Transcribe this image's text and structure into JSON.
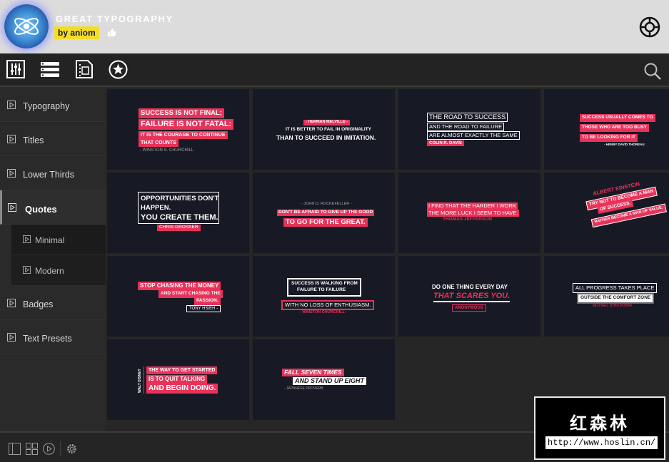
{
  "header": {
    "app_title": "GREAT TYPOGRAPHY",
    "author": "by aniom"
  },
  "sidebar": {
    "categories": [
      {
        "label": "Typography"
      },
      {
        "label": "Titles"
      },
      {
        "label": "Lower Thirds"
      },
      {
        "label": "Quotes"
      },
      {
        "label": "Badges"
      },
      {
        "label": "Text Presets"
      }
    ],
    "subcategories": [
      {
        "label": "Minimal"
      },
      {
        "label": "Modern"
      }
    ]
  },
  "tiles": [
    {
      "lines": [
        "SUCCESS IS NOT FINAL;",
        "FAILURE IS NOT FATAL:",
        "IT IS THE COURAGE TO CONTINUE",
        "THAT COUNTS",
        "- WINSTON S. CHURCHILL"
      ]
    },
    {
      "lines": [
        "- HERMAN MELVILLE -",
        "IT IS BETTER TO FAIL IN ORIGINALITY",
        "THAN TO SUCCEED IN IMITATION."
      ]
    },
    {
      "lines": [
        "THE ROAD TO SUCCESS",
        "AND THE ROAD TO FAILURE",
        "ARE ALMOST EXACTLY THE SAME",
        "COLIN R. DAVIS"
      ]
    },
    {
      "lines": [
        "SUCCESS USUALLY COMES TO",
        "THOSE WHO ARE TOO BUSY",
        "TO BE LOOKING FOR IT",
        "- HENRY DAVID THOREAU"
      ]
    },
    {
      "lines": [
        "OPPORTUNITIES DON'T",
        "HAPPEN.",
        "YOU CREATE THEM.",
        "CHRIS GROSSER"
      ]
    },
    {
      "lines": [
        "- JOHN D. ROCKEFELLER -",
        "DON'T BE AFRAID TO GIVE UP THE GOOD",
        "TO GO FOR THE GREAT."
      ]
    },
    {
      "lines": [
        "I FIND THAT THE HARDER I WORK",
        "THE MORE LUCK I SEEM TO HAVE.",
        "THOMAS JEFFERSON"
      ]
    },
    {
      "lines": [
        "ALBERT EINSTEIN",
        "TRY NOT TO BECOME A MAN",
        "OF SUCCESS.",
        "RATHER BECOME A MAN OF VALUE."
      ]
    },
    {
      "lines": [
        "STOP CHASING THE MONEY",
        "AND START CHASING THE",
        "PASSION.",
        "TONY HSIEH -"
      ]
    },
    {
      "lines": [
        "SUCCESS IS WALKING FROM",
        "FAILURE TO FAILURE",
        "WITH NO LOSS OF ENTHUSIASM.",
        "- WINSTON CHURCHILL -"
      ]
    },
    {
      "lines": [
        "DO ONE THING EVERY DAY",
        "THAT SCARES YOU.",
        "ANONYMOUS"
      ]
    },
    {
      "lines": [
        "ALL PROGRESS TAKES PLACE",
        "OUTSIDE THE COMFORT ZONE",
        "MICHAEL JOHN BOBAK"
      ]
    },
    {
      "lines": [
        "WALT DISNEY",
        "THE WAY TO GET STARTED",
        "IS TO QUIT TALKING",
        "AND BEGIN DOING."
      ]
    },
    {
      "lines": [
        "FALL SEVEN TIMES",
        "AND STAND UP EIGHT",
        "- JAPANESE PROVERB"
      ]
    }
  ],
  "watermark": {
    "chinese": "红森林",
    "url": "http://www.hoslin.cn/"
  },
  "icons": {
    "logo": "atom-logo-icon",
    "like": "thumbs-up-icon",
    "help": "lifebuoy-icon",
    "toolbar": [
      "sliders-icon",
      "list-icon",
      "film-icon",
      "star-icon"
    ],
    "search": "search-icon",
    "bottom": [
      "panel-icon",
      "grid-icon",
      "play-icon",
      "gear-icon"
    ]
  },
  "colors": {
    "accent": "#e8325a",
    "badge": "#f3dd2b",
    "tile_bg": "#171a25"
  }
}
